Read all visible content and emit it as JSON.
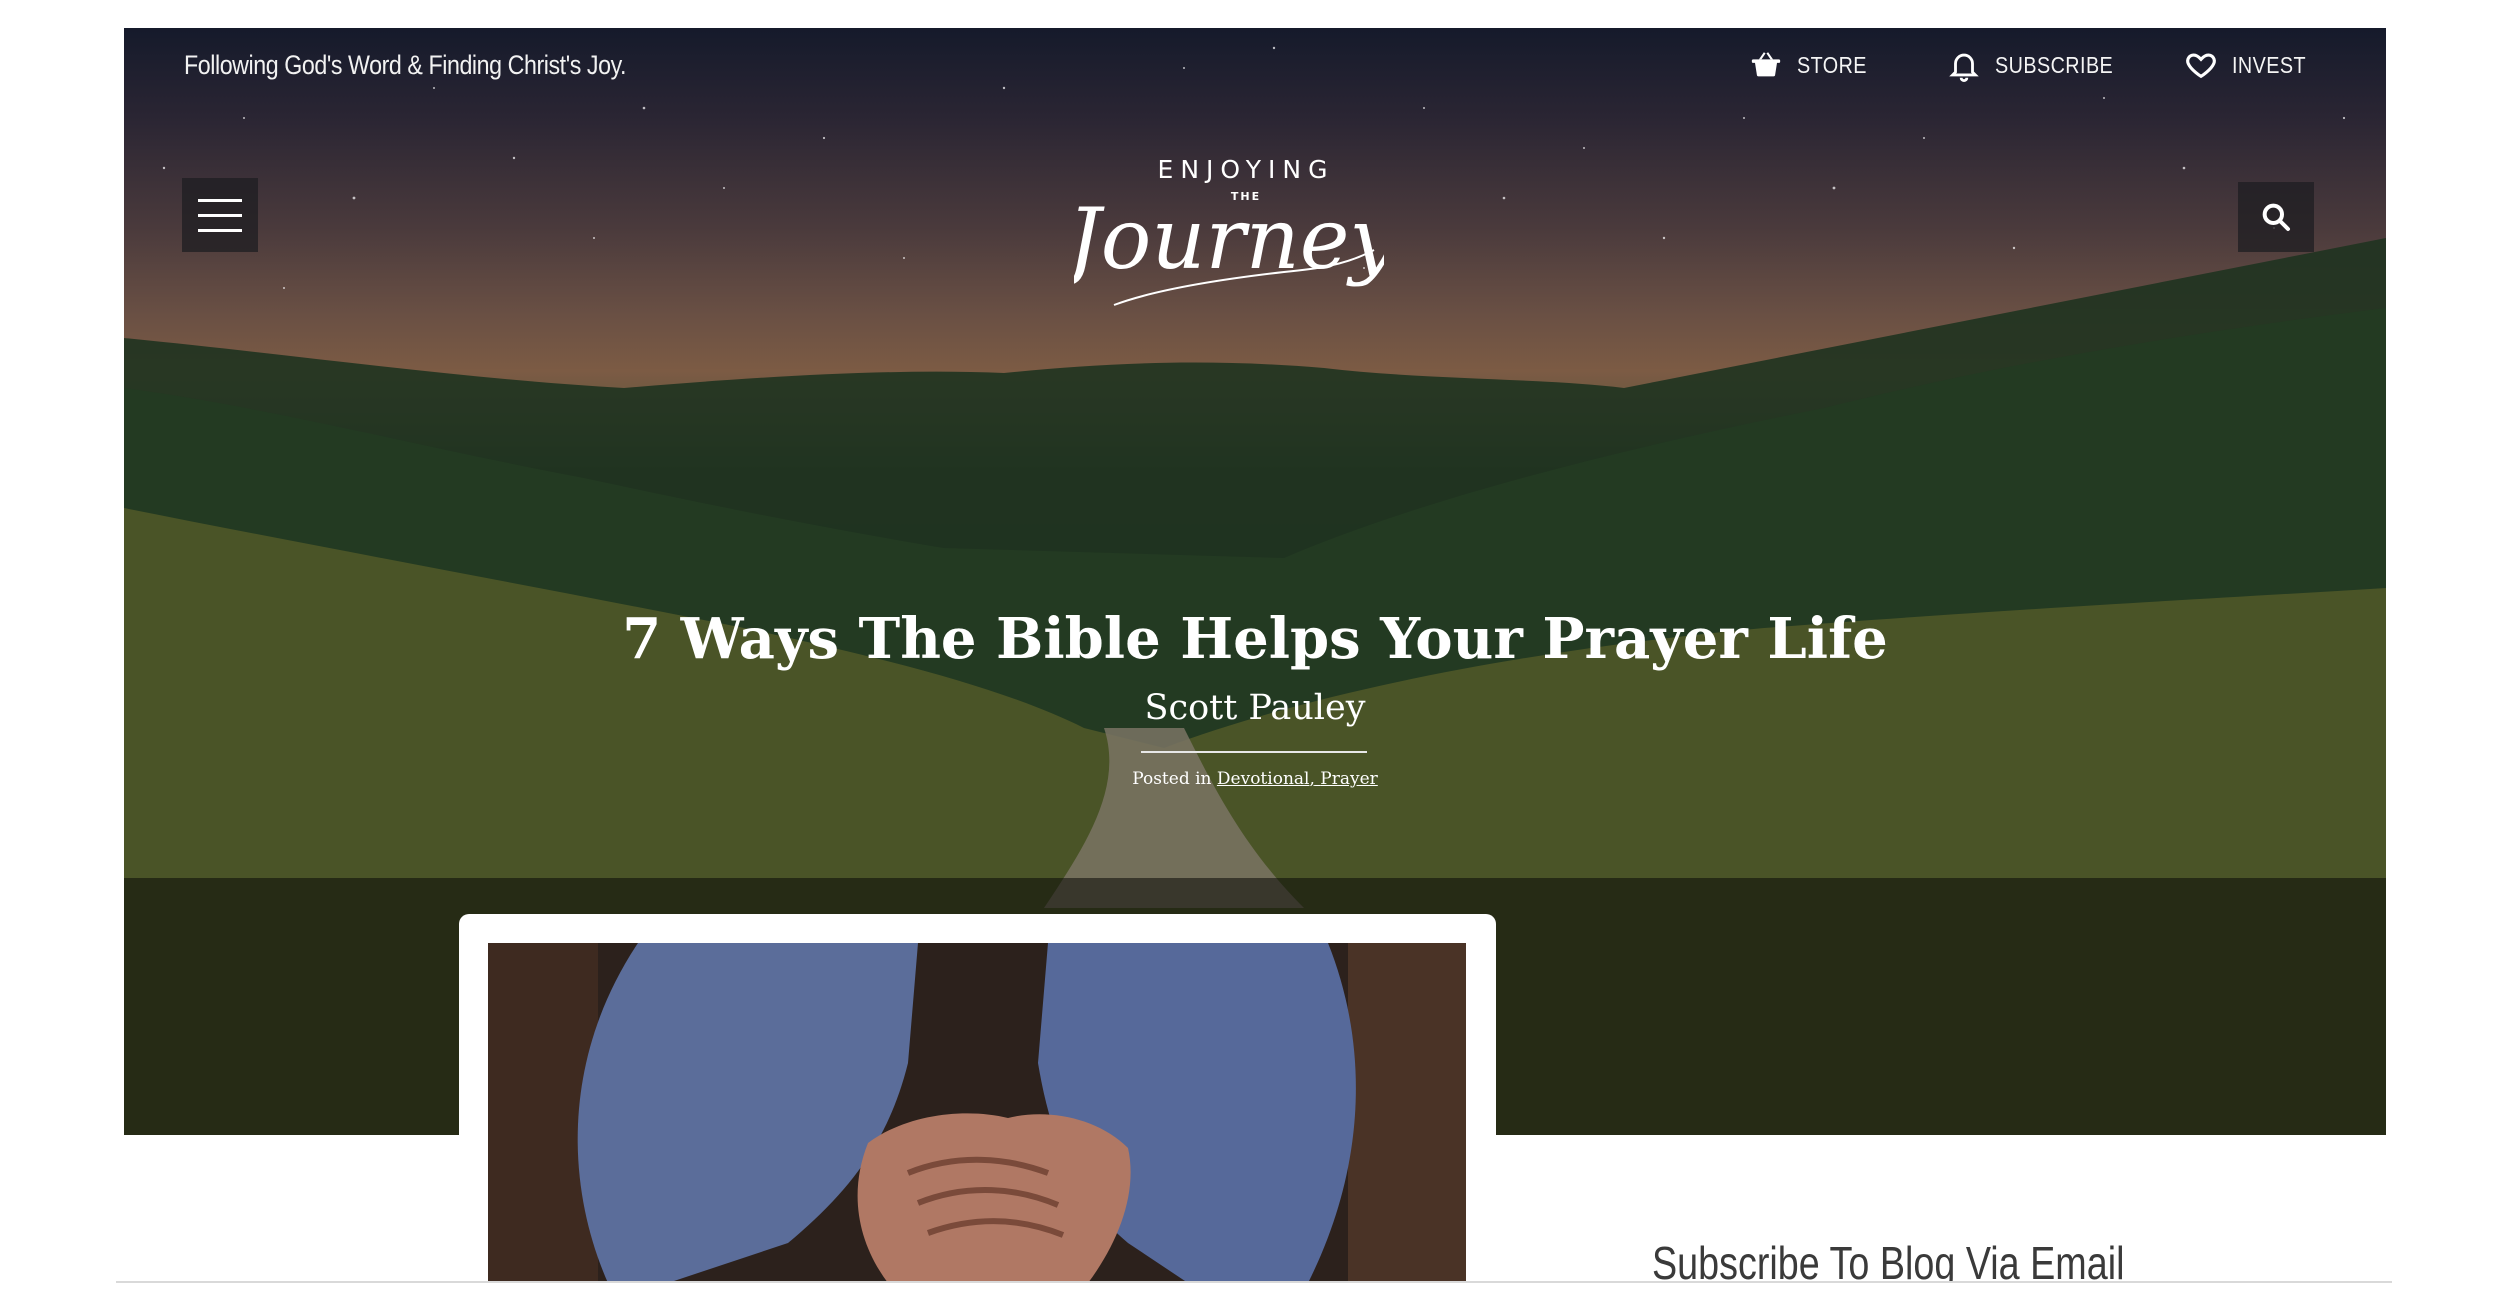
{
  "topbar": {
    "tagline": "Following God's Word & Finding Christ's Joy.",
    "links": [
      {
        "label": "STORE",
        "icon": "basket-icon"
      },
      {
        "label": "SUBSCRIBE",
        "icon": "bell-icon"
      },
      {
        "label": "INVEST",
        "icon": "heart-icon"
      }
    ]
  },
  "logo": {
    "line1": "ENJOYING",
    "line2": "THE",
    "line3": "Journey"
  },
  "post": {
    "title": "7 Ways The Bible Helps Your Prayer Life",
    "author": "Scott Pauley",
    "posted_in_prefix": "Posted in",
    "category_1": "Devotional",
    "category_separator": ",",
    "category_2": "Prayer"
  },
  "sidebar": {
    "heading": "Subscribe To Blog Via Email"
  },
  "colors": {
    "text_light": "#ffffff",
    "button_bg": "#1e1e22",
    "sidebar_heading": "#3a3a3a"
  }
}
